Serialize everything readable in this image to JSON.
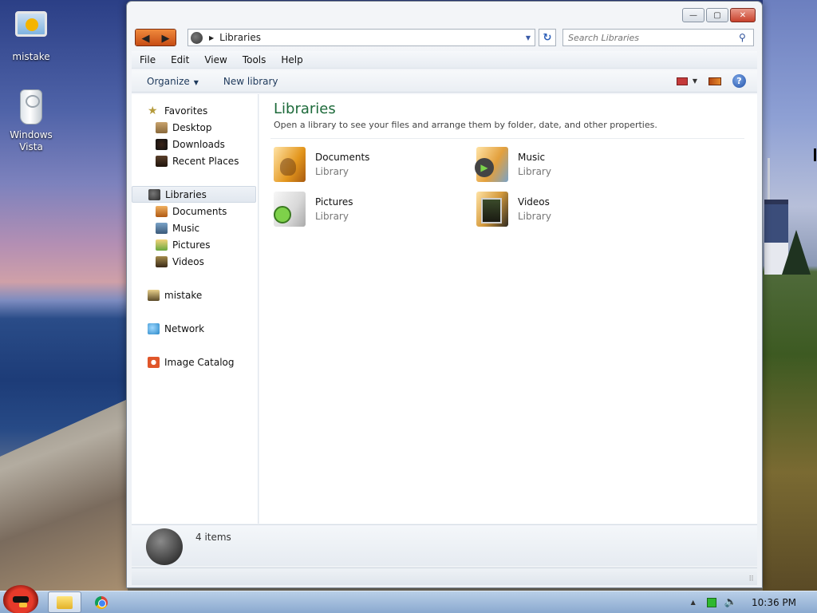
{
  "desktop": {
    "icons": [
      {
        "label": "mistake"
      },
      {
        "label": "Windows Vista"
      }
    ]
  },
  "window": {
    "caption_buttons": {
      "minimize": "—",
      "maximize": "▢",
      "close": "✕"
    },
    "nav": {
      "back": "◀",
      "forward": "▶"
    },
    "address": {
      "separator": "▶",
      "current": "Libraries",
      "dropdown": "▼",
      "refresh": "↻"
    },
    "search": {
      "placeholder": "Search Libraries",
      "icon": "⚲"
    },
    "menu": [
      "File",
      "Edit",
      "View",
      "Tools",
      "Help"
    ],
    "toolbar": {
      "organize": "Organize",
      "organize_caret": "▼",
      "new_library": "New library",
      "views_caret": "▼",
      "help": "?"
    },
    "nav_pane": {
      "favorites": {
        "label": "Favorites",
        "star": "★",
        "items": [
          "Desktop",
          "Downloads",
          "Recent Places"
        ]
      },
      "libraries": {
        "label": "Libraries",
        "items": [
          "Documents",
          "Music",
          "Pictures",
          "Videos"
        ]
      },
      "homegroup": "mistake",
      "network": "Network",
      "catalog": "Image Catalog"
    },
    "content": {
      "title": "Libraries",
      "subtitle": "Open a library to see your files and arrange them by folder, date, and other properties.",
      "libraries": [
        {
          "name": "Documents",
          "kind": "Library"
        },
        {
          "name": "Music",
          "kind": "Library"
        },
        {
          "name": "Pictures",
          "kind": "Library"
        },
        {
          "name": "Videos",
          "kind": "Library"
        }
      ]
    },
    "details": {
      "count": "4 items"
    },
    "status": {
      "grip": "⠿"
    }
  },
  "taskbar": {
    "tray": {
      "arrow": "▲",
      "volume": "🔈",
      "clock": "10:36 PM"
    }
  }
}
